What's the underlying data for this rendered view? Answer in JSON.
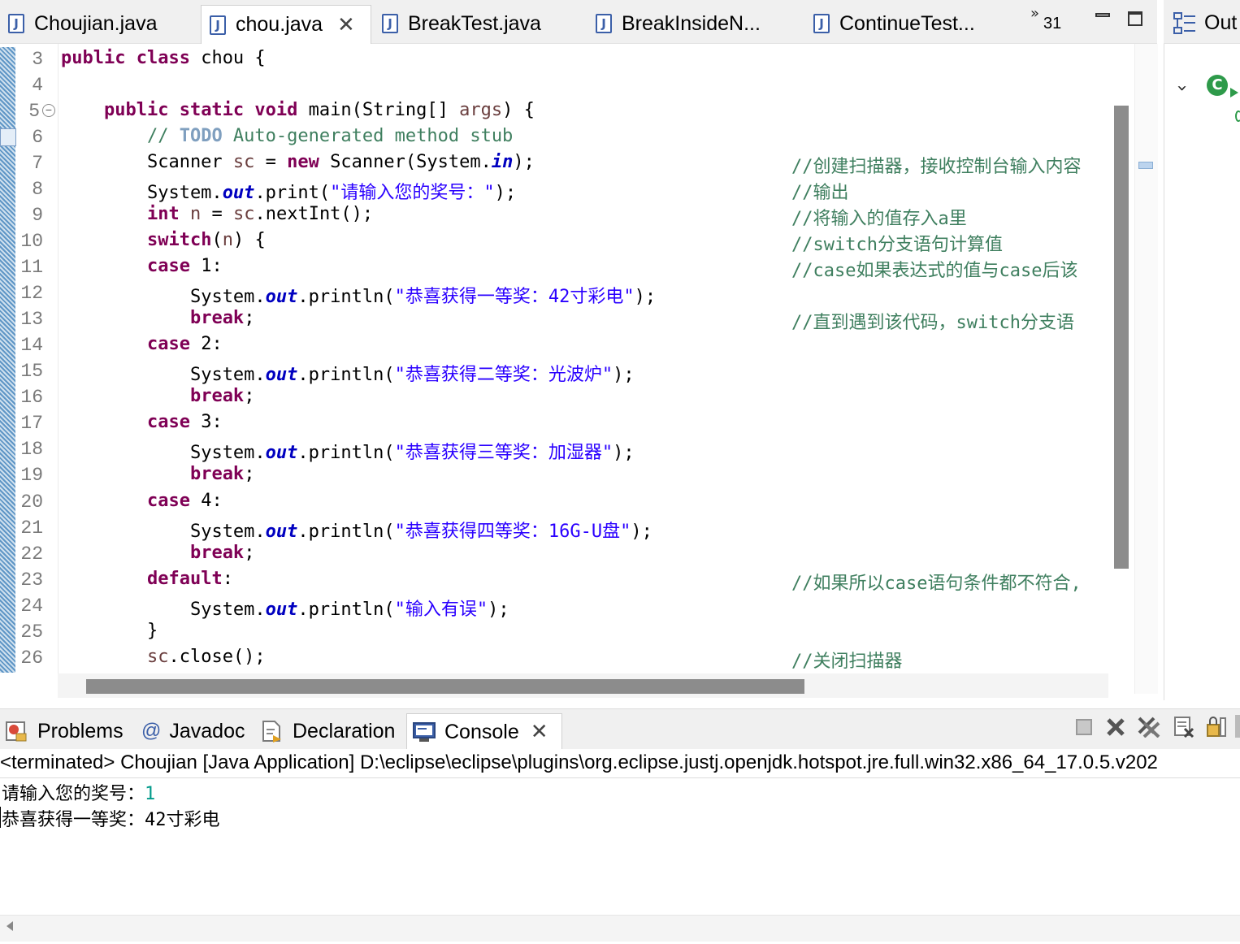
{
  "editor_tabs": [
    {
      "label": "Choujian.java",
      "active": false
    },
    {
      "label": "chou.java",
      "active": true
    },
    {
      "label": "BreakTest.java",
      "active": false
    },
    {
      "label": "BreakInsideN...",
      "active": false
    },
    {
      "label": "ContinueTest...",
      "active": false
    }
  ],
  "tab_overflow": {
    "glyph": "»",
    "count": "31"
  },
  "outline": {
    "label": "Out",
    "class_icon": "C"
  },
  "editor": {
    "line_numbers": [
      "3",
      "4",
      "5",
      "6",
      "7",
      "8",
      "9",
      "10",
      "11",
      "12",
      "13",
      "14",
      "15",
      "16",
      "17",
      "18",
      "19",
      "20",
      "21",
      "22",
      "23",
      "24",
      "25",
      "26"
    ],
    "code": {
      "l3_kw": "public class",
      "l3_rest": " chou {",
      "l5_indent": "    ",
      "l5_kw": "public static void",
      "l5_rest": " main(String[] ",
      "l5_var": "args",
      "l5_end": ") {",
      "l6_slashes": "        // ",
      "l6_todo": "TODO",
      "l6_rest": " Auto-generated method stub",
      "l7_a": "        Scanner ",
      "l7_var": "sc",
      "l7_b": " = ",
      "l7_kw": "new",
      "l7_c": " Scanner(System.",
      "l7_fld": "in",
      "l7_d": ");",
      "l8_a": "        System.",
      "l8_fld": "out",
      "l8_b": ".print(",
      "l8_str": "\"请输入您的奖号：\"",
      "l8_c": ");",
      "l9_kw": "int",
      "l9_var1": "n",
      "l9_b": " = ",
      "l9_var2": "sc",
      "l9_c": ".nextInt();",
      "l10_kw": "switch",
      "l10_b": "(",
      "l10_var": "n",
      "l10_c": ") {",
      "case_kw": "case",
      "l11_val": " 1:",
      "println_a": "System.",
      "println_fld": "out",
      "println_b": ".println(",
      "println_end": ");",
      "l12_str": "\"恭喜获得一等奖：42寸彩电\"",
      "break_kw": "break",
      "semi": ";",
      "l14_val": " 2:",
      "l15_str": "\"恭喜获得二等奖：光波炉\"",
      "l17_val": " 3:",
      "l18_str": "\"恭喜获得三等奖：加湿器\"",
      "l20_val": " 4:",
      "l21_str": "\"恭喜获得四等奖：16G-U盘\"",
      "l23_kw": "default",
      "l23_b": ":",
      "l24_str": "\"输入有误\"",
      "l25": "        }",
      "l26_var": "sc",
      "l26_b": ".close();"
    },
    "comments": {
      "l7": "//创建扫描器，接收控制台输入内容",
      "l8": "//输出",
      "l9": "//将输入的值存入a里",
      "l10": "//switch分支语句计算值",
      "l11": "//case如果表达式的值与case后该",
      "l13": "//直到遇到该代码，switch分支语",
      "l23": "//如果所以case语句条件都不符合,",
      "l26": "//关闭扫描器"
    }
  },
  "bottom_tabs": [
    {
      "label": "Problems",
      "icon": "problems-icon"
    },
    {
      "label": "Javadoc",
      "icon": "at-icon",
      "glyph": "@"
    },
    {
      "label": "Declaration",
      "icon": "declaration-icon"
    },
    {
      "label": "Console",
      "icon": "console-icon",
      "active": true
    }
  ],
  "console": {
    "terminated": "<terminated> Choujian [Java Application] D:\\eclipse\\eclipse\\plugins\\org.eclipse.justj.openjdk.hotspot.jre.full.win32.x86_64_17.0.5.v202",
    "prompt": "请输入您的奖号：",
    "input": "1",
    "result": "恭喜获得一等奖：42寸彩电"
  },
  "colors": {
    "keyword": "#7f0055",
    "string": "#2a00ff",
    "comment": "#3f7f5f",
    "field": "#0000c0",
    "console_input": "#009a8a"
  }
}
